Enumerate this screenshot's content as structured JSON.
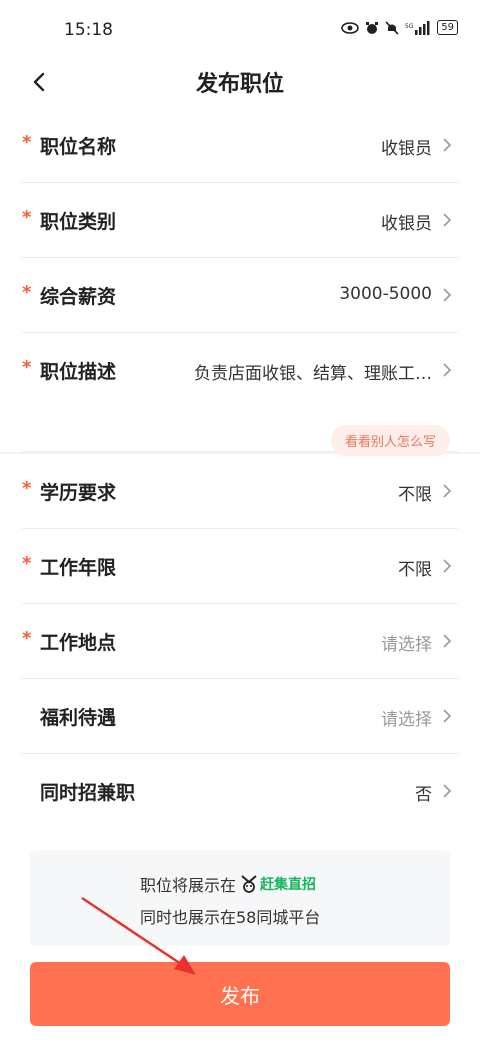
{
  "status_bar": {
    "time": "15:18",
    "battery": "59"
  },
  "header": {
    "title": "发布职位"
  },
  "form": {
    "rows": [
      {
        "label": "职位名称",
        "value": "收银员",
        "required": true,
        "muted": false
      },
      {
        "label": "职位类别",
        "value": "收银员",
        "required": true,
        "muted": false
      },
      {
        "label": "综合薪资",
        "value": "3000-5000",
        "required": true,
        "muted": false
      },
      {
        "label": "职位描述",
        "value": "负责店面收银、结算、理账工…",
        "required": true,
        "muted": false,
        "tip": "看看别人怎么写"
      },
      {
        "label": "学历要求",
        "value": "不限",
        "required": true,
        "muted": false
      },
      {
        "label": "工作年限",
        "value": "不限",
        "required": true,
        "muted": false
      },
      {
        "label": "工作地点",
        "value": "请选择",
        "required": true,
        "muted": true
      },
      {
        "label": "福利待遇",
        "value": "请选择",
        "required": false,
        "muted": true
      },
      {
        "label": "同时招兼职",
        "value": "否",
        "required": false,
        "muted": false
      }
    ],
    "required_mark": "*"
  },
  "info": {
    "line1": "职位将展示在",
    "brand": "赶集直招",
    "line2": "同时也展示在58同城平台"
  },
  "publish_button": "发布",
  "colors": {
    "accent": "#ff7150",
    "required": "#ff5a3c",
    "brand_green": "#16b65d",
    "arrow": "#e8322b"
  },
  "icons": [
    "eye-icon",
    "alarm-icon",
    "mute-icon",
    "signal-icon",
    "battery-icon",
    "back-icon",
    "chevron-right-icon",
    "brand-logo-icon"
  ]
}
